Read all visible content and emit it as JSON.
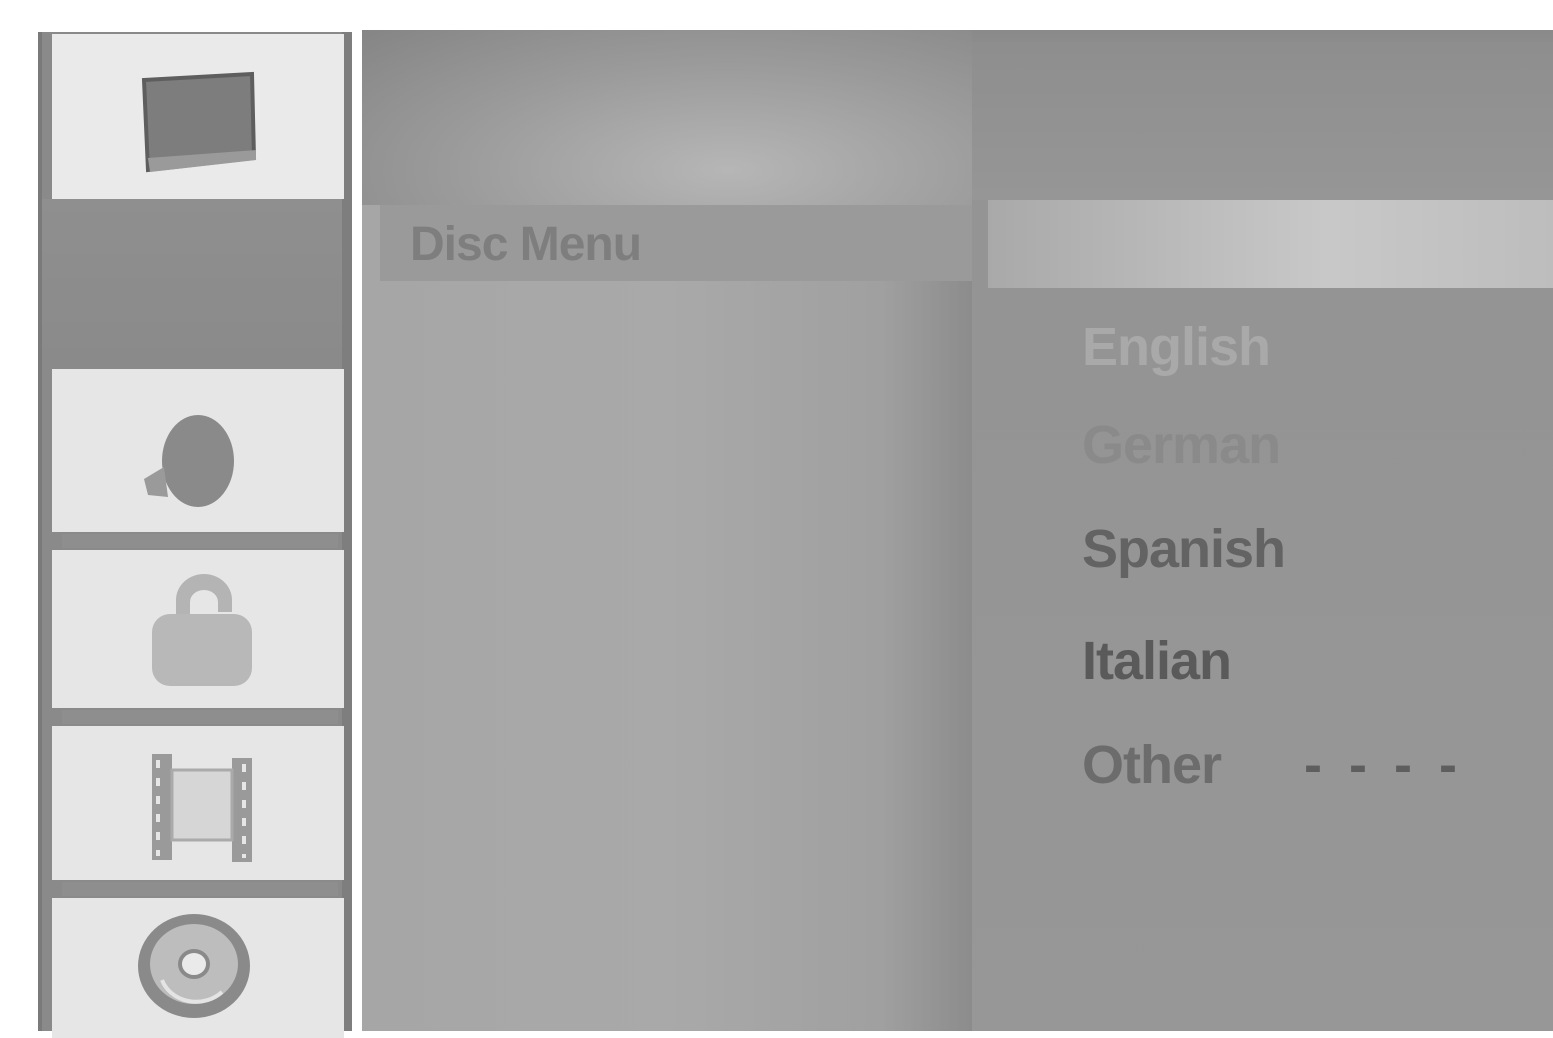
{
  "sidebar": {
    "icons": [
      {
        "name": "tv-screen-icon"
      },
      {
        "name": "audio-speaker-icon"
      },
      {
        "name": "padlock-icon"
      },
      {
        "name": "film-strip-icon"
      },
      {
        "name": "disc-icon"
      }
    ]
  },
  "menu": {
    "selected_item_label": "Disc Menu"
  },
  "options": {
    "items": [
      "English",
      "German",
      "Spanish",
      "Italian",
      "Other"
    ],
    "other_code": "- - - -"
  }
}
